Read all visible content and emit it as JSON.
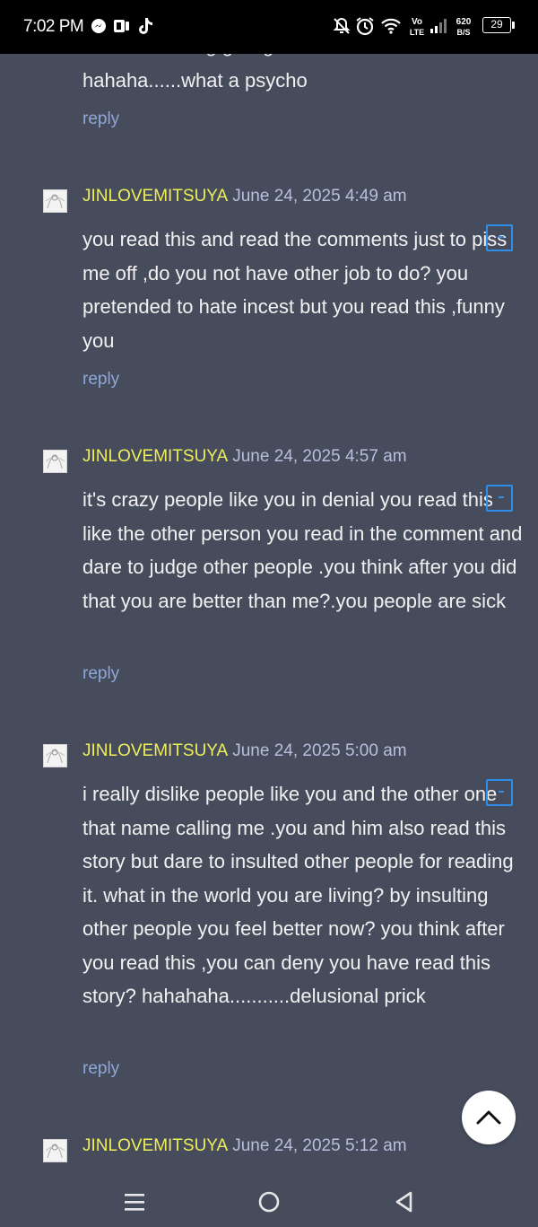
{
  "status_bar": {
    "time": "7:02 PM",
    "volte": "Vo",
    "lte": "LTE",
    "speed_value": "620",
    "speed_unit": "B/S",
    "battery": "29"
  },
  "top_fragment": {
    "cut_text": "read it and t'ing giving bad comments",
    "text": "hahaha......what a psycho",
    "reply": "reply"
  },
  "comments": [
    {
      "author": "JINLOVEMITSUYA",
      "date": "June 24, 2025 4:49 am",
      "text": "you read this and read the comments just to piss me off ,do you not have other job to do? you pretended to hate incest but you read this ,funny you",
      "reply": "reply"
    },
    {
      "author": "JINLOVEMITSUYA",
      "date": "June 24, 2025 4:57 am",
      "text": "it's crazy people like you in denial you read this like the other person you read in the comment and dare to judge other people .you think after you did that you are better than me?.you people are sick",
      "reply": "reply"
    },
    {
      "author": "JINLOVEMITSUYA",
      "date": "June 24, 2025 5:00 am",
      "text": "i really dislike people like you and the other one that name calling me .you and him also read this story but dare to insulted other people for reading it. what in the world you are living? by insulting other people you feel better now? you think after you read this ,you can deny you have read this story? hahahaha...........delusional prick",
      "reply": "reply"
    },
    {
      "author": "JINLOVEMITSUYA",
      "date": "June 24, 2025 5:12 am"
    }
  ],
  "icons": {
    "scroll_top": "chevron-up-icon",
    "nav_menu": "menu-icon",
    "nav_home": "home-circle-icon",
    "nav_back": "back-triangle-icon"
  },
  "colors": {
    "background": "#474c5d",
    "author": "#eeee5a",
    "date": "#b7bfdc",
    "reply": "#8fa6d6",
    "text": "#f1f1f1"
  }
}
